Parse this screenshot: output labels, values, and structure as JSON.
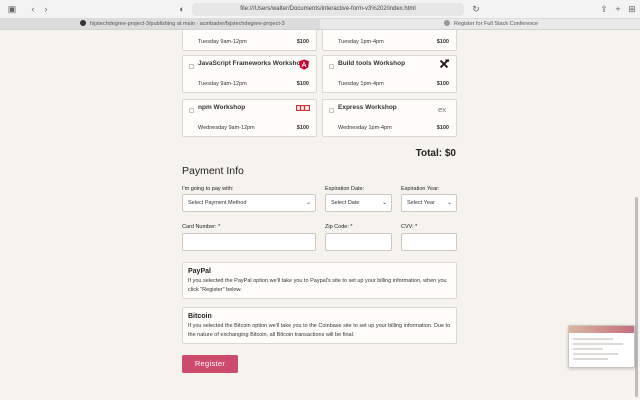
{
  "browser": {
    "url": "file:///Users/walter/Documents/interactive-form-v3%202/index.html",
    "tabs": [
      {
        "label": "fsjstechdegree-project-3/publishing at main · acmbader/fsjstechdegree-project-3"
      },
      {
        "label": "Register for Full Stack Conference"
      }
    ]
  },
  "activities": [
    {
      "name": "",
      "time": "Tuesday 9am-12pm",
      "price": "$100",
      "logo": ""
    },
    {
      "name": "",
      "time": "Tuesday 1pm-4pm",
      "price": "$100",
      "logo": ""
    },
    {
      "name": "JavaScript Frameworks Workshop",
      "time": "Tuesday 9am-12pm",
      "price": "$100",
      "logo": "angular-icon"
    },
    {
      "name": "Build tools Workshop",
      "time": "Tuesday 1pm-4pm",
      "price": "$100",
      "logo": "tools-icon"
    },
    {
      "name": "npm Workshop",
      "time": "Wednesday 9am-12pm",
      "price": "$100",
      "logo": "npm-icon"
    },
    {
      "name": "Express Workshop",
      "time": "Wednesday 1pm-4pm",
      "price": "$100",
      "logo": "express-icon"
    }
  ],
  "total": "Total: $0",
  "payment": {
    "title": "Payment Info",
    "pay_with_label": "I'm going to pay with:",
    "pay_with_value": "Select Payment Method",
    "exp_date_label": "Expiration Date:",
    "exp_date_value": "Select Date",
    "exp_year_label": "Expiration Year:",
    "exp_year_value": "Select Year",
    "card_label": "Card Number: *",
    "zip_label": "Zip Code: *",
    "cvv_label": "CVV: *"
  },
  "paypal": {
    "title": "PayPal",
    "text": "If you selected the PayPal option we'll take you to Paypal's site to set up your billing information, when you click \"Register\" below."
  },
  "bitcoin": {
    "title": "Bitcoin",
    "text": "If you selected the Bitcoin option we'll take you to the Coinbase site to set up your billing information. Due to the nature of exchanging Bitcoin, all Bitcoin transactions will be final."
  },
  "register_label": "Register",
  "colors": {
    "accent": "#cc4a6b",
    "background": "#f6f3ee",
    "angular": "#dd0031",
    "npm": "#cb3837"
  }
}
